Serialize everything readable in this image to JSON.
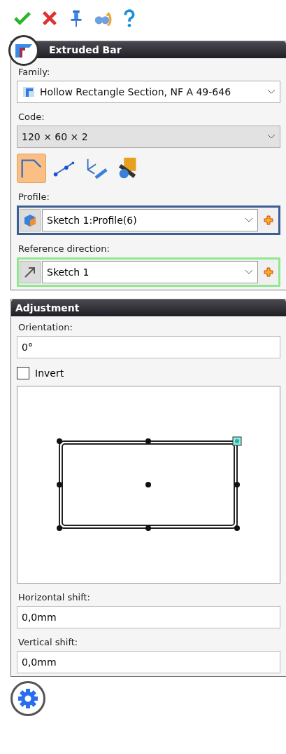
{
  "toolbar": [
    {
      "kind": "ok"
    },
    {
      "kind": "cancel"
    },
    {
      "kind": "pin"
    },
    {
      "kind": "preview"
    },
    {
      "kind": "help"
    }
  ],
  "panel": {
    "title": "Extruded Bar",
    "family": {
      "label": "Family:",
      "value": "Hollow Rectangle Section, NF A 49-646"
    },
    "code": {
      "label": "Code:",
      "value": "120 × 60 × 2"
    },
    "modes": [
      {
        "kind": "profile",
        "selected": true
      },
      {
        "kind": "points",
        "selected": false
      },
      {
        "kind": "axis",
        "selected": false
      },
      {
        "kind": "tube",
        "selected": false
      }
    ],
    "selectors": [
      {
        "label": "Profile:",
        "value": "Sketch 1:Profile(6)",
        "kind": "cube",
        "color": "#3c5f93"
      },
      {
        "label": "Reference direction:",
        "value": "Sketch 1",
        "kind": "arrow",
        "color": "#90e890"
      }
    ]
  },
  "adjustment": {
    "title": "Adjustment",
    "orientation": {
      "label": "Orientation:",
      "value": "0°"
    },
    "invert": {
      "label": "Invert",
      "checked": false
    },
    "shifts": [
      {
        "label": "Horizontal shift:",
        "value": "0,0mm"
      },
      {
        "label": "Vertical shift:",
        "value": "0,0mm"
      }
    ]
  }
}
